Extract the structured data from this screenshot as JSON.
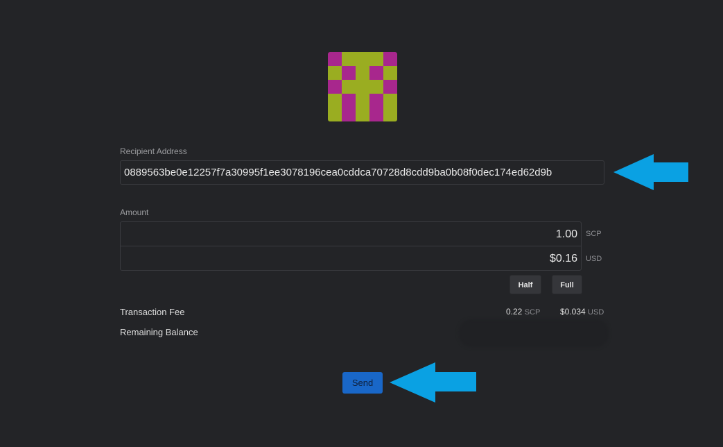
{
  "identicon": {
    "colors": {
      "fg": "#9aad21",
      "bg": "#a8278d"
    },
    "cells": [
      [
        0,
        1,
        1,
        1,
        0
      ],
      [
        1,
        0,
        1,
        0,
        1
      ],
      [
        0,
        1,
        1,
        1,
        0
      ],
      [
        1,
        0,
        1,
        0,
        1
      ],
      [
        1,
        0,
        1,
        0,
        1
      ]
    ]
  },
  "recipient": {
    "label": "Recipient Address",
    "value": "0889563be0e12257f7a30995f1ee3078196cea0cddca70728d8cdd9ba0b08f0dec174ed62d9b"
  },
  "amount": {
    "label": "Amount",
    "scp_value": "1.00",
    "scp_unit": "SCP",
    "usd_value": "$0.16",
    "usd_unit": "USD",
    "half_label": "Half",
    "full_label": "Full"
  },
  "fee": {
    "label": "Transaction Fee",
    "scp_value": "0.22",
    "scp_unit": "SCP",
    "usd_value": "$0.034",
    "usd_unit": "USD"
  },
  "remaining": {
    "label": "Remaining Balance"
  },
  "send_label": "Send",
  "annotation_color": "#0aa1e3"
}
